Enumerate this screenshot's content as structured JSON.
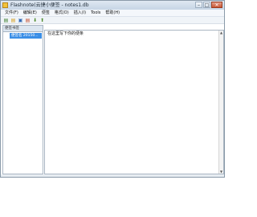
{
  "window": {
    "title": "Flashnote(云捷小便签 - notes1.db",
    "controls": {
      "minimize": "–",
      "maximize": "□",
      "close": "✕"
    }
  },
  "menu": {
    "items": [
      {
        "label": "文件(F)"
      },
      {
        "label": "编辑(E)"
      },
      {
        "label": "便签"
      },
      {
        "label": "格式(O)"
      },
      {
        "label": "插入(I)"
      },
      {
        "label": "Tools"
      },
      {
        "label": "帮助(H)"
      }
    ]
  },
  "toolbar": {
    "buttons": [
      {
        "icon": "new-note-icon",
        "glyph": "▤",
        "color": "#3b7d2b"
      },
      {
        "icon": "new-folder-icon",
        "glyph": "▤",
        "color": "#d59a18"
      },
      {
        "icon": "open-icon",
        "glyph": "▣",
        "color": "#2f66b3"
      },
      {
        "icon": "delete-icon",
        "glyph": "▤",
        "color": "#c44b2a"
      },
      {
        "icon": "move-down-icon",
        "glyph": "⬇",
        "color": "#4d8a2c"
      },
      {
        "icon": "move-up-icon",
        "glyph": "⬆",
        "color": "#4d8a2c"
      }
    ]
  },
  "sidebar": {
    "header": "便签书签",
    "items": [
      {
        "label": "便签名 20150..."
      }
    ]
  },
  "editor": {
    "text": "在这里写下你的便条"
  },
  "colors": {
    "selection": "#3a8ee6",
    "titlebar": "#c6d5e5",
    "border": "#aab6c3"
  }
}
